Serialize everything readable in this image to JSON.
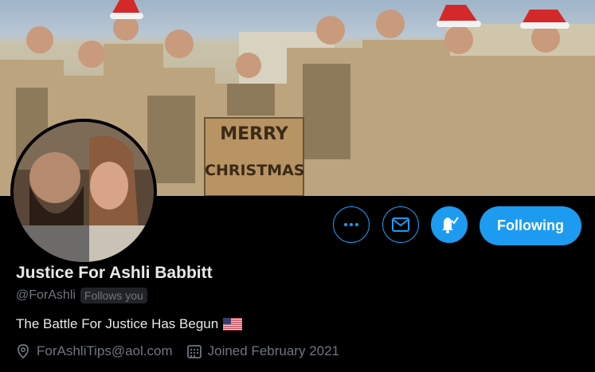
{
  "profile": {
    "name": "Justice For Ashli Babbitt",
    "handle": "@ForAshli",
    "follows_you": "Follows you",
    "bio": "The Battle For Justice Has Begun",
    "bio_flag": "us-flag-emoji",
    "email": "ForAshliTips@aol.com",
    "joined": "Joined February 2021"
  },
  "banner": {
    "sign_text_1": "MERRY",
    "sign_text_2": "CHRISTMAS"
  },
  "actions": {
    "more_icon": "more-dots-icon",
    "mail_icon": "mail-icon",
    "bell_icon": "bell-check-icon",
    "follow_label": "Following"
  },
  "colors": {
    "accent": "#1d9bf0",
    "background": "#000000",
    "muted_text": "#6e767d"
  }
}
